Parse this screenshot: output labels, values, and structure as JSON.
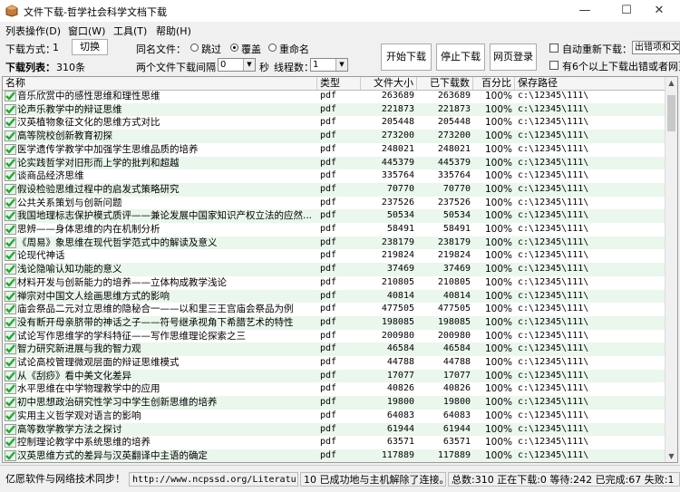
{
  "window": {
    "title": "文件下载-哲学社会科学文档下载",
    "minimize": "—",
    "maximize": "☐",
    "close": "✕"
  },
  "menu": [
    "列表操作(D)",
    "窗口(W)",
    "工具(T)",
    "帮助(H)"
  ],
  "toolbar": {
    "download_mode_label": "下载方式：",
    "download_mode_value": "1",
    "switch_button": "切换",
    "download_list_label": "下载列表：",
    "download_list_count": "310条",
    "same_name_label": "同名文件：",
    "radio_skip": "跳过",
    "radio_overwrite": "覆盖",
    "radio_rename": "重命名",
    "interval_label": "两个文件下载间隔：",
    "interval_value": "0",
    "interval_unit": "秒",
    "threads_label": "线程数：",
    "threads_value": "1",
    "start_button": "开始下载",
    "stop_button": "停止下载",
    "login_button": "网页登录",
    "auto_redownload_label": "自动重新下载：",
    "auto_redownload_value": "出错项和文",
    "above_six_label": "有6个以上下载出错或者网页"
  },
  "table": {
    "columns": [
      "名称",
      "类型",
      "文件大小",
      "已下载数",
      "百分比",
      "保存路径"
    ],
    "rows": [
      [
        "音乐欣赏中的感性思维和理性思维",
        "pdf",
        "263689",
        "263689",
        "100%",
        "c:\\12345\\111\\"
      ],
      [
        "论声乐教学中的辩证思维",
        "pdf",
        "221873",
        "221873",
        "100%",
        "c:\\12345\\111\\"
      ],
      [
        "汉英植物象征文化的思维方式对比",
        "pdf",
        "205448",
        "205448",
        "100%",
        "c:\\12345\\111\\"
      ],
      [
        "高等院校创新教育初探",
        "pdf",
        "273200",
        "273200",
        "100%",
        "c:\\12345\\111\\"
      ],
      [
        "医学遗传学教学中加强学生思维品质的培养",
        "pdf",
        "248021",
        "248021",
        "100%",
        "c:\\12345\\111\\"
      ],
      [
        "论实践哲学对旧形而上学的批判和超越",
        "pdf",
        "445379",
        "445379",
        "100%",
        "c:\\12345\\111\\"
      ],
      [
        "谈商品经济思维",
        "pdf",
        "335764",
        "335764",
        "100%",
        "c:\\12345\\111\\"
      ],
      [
        "假设检验思维过程中的启发式策略研究",
        "pdf",
        "70770",
        "70770",
        "100%",
        "c:\\12345\\111\\"
      ],
      [
        "公共关系策划与创新问题",
        "pdf",
        "237526",
        "237526",
        "100%",
        "c:\\12345\\111\\"
      ],
      [
        "我国地理标志保护模式质评——兼论发展中国家知识产权立法的应然...",
        "pdf",
        "50534",
        "50534",
        "100%",
        "c:\\12345\\111\\"
      ],
      [
        "思辨——身体思维的内在机制分析",
        "pdf",
        "58491",
        "58491",
        "100%",
        "c:\\12345\\111\\"
      ],
      [
        "《周易》象思维在现代哲学范式中的解读及意义",
        "pdf",
        "238179",
        "238179",
        "100%",
        "c:\\12345\\111\\"
      ],
      [
        "论现代神话",
        "pdf",
        "219824",
        "219824",
        "100%",
        "c:\\12345\\111\\"
      ],
      [
        "浅论隐喻认知功能的意义",
        "pdf",
        "37469",
        "37469",
        "100%",
        "c:\\12345\\111\\"
      ],
      [
        "材料开发与创新能力的培养——立体构成教学浅论",
        "pdf",
        "210805",
        "210805",
        "100%",
        "c:\\12345\\111\\"
      ],
      [
        "禅宗对中国文人绘画思维方式的影响",
        "pdf",
        "40814",
        "40814",
        "100%",
        "c:\\12345\\111\\"
      ],
      [
        "庙会祭品二元对立思维的隐秘合一——以和里三王宫庙会祭品为例",
        "pdf",
        "477505",
        "477505",
        "100%",
        "c:\\12345\\111\\"
      ],
      [
        "没有断开母亲脐带的神话之子——符号继承视角下希腊艺术的特性",
        "pdf",
        "198085",
        "198085",
        "100%",
        "c:\\12345\\111\\"
      ],
      [
        "试论写作思维学的学科特征——写作思维理论探索之三",
        "pdf",
        "200980",
        "200980",
        "100%",
        "c:\\12345\\111\\"
      ],
      [
        "智力研究新进展与我的智力观",
        "pdf",
        "46584",
        "46584",
        "100%",
        "c:\\12345\\111\\"
      ],
      [
        "试论高校管理微观层面的辩证思维模式",
        "pdf",
        "44788",
        "44788",
        "100%",
        "c:\\12345\\111\\"
      ],
      [
        "从《刮痧》看中美文化差异",
        "pdf",
        "17077",
        "17077",
        "100%",
        "c:\\12345\\111\\"
      ],
      [
        "水平思维在中学物理教学中的应用",
        "pdf",
        "40826",
        "40826",
        "100%",
        "c:\\12345\\111\\"
      ],
      [
        "初中思想政治研究性学习中学生创新思维的培养",
        "pdf",
        "19800",
        "19800",
        "100%",
        "c:\\12345\\111\\"
      ],
      [
        "实用主义哲学观对语言的影响",
        "pdf",
        "64083",
        "64083",
        "100%",
        "c:\\12345\\111\\"
      ],
      [
        "高等数学教学方法之探讨",
        "pdf",
        "61944",
        "61944",
        "100%",
        "c:\\12345\\111\\"
      ],
      [
        "控制理论教学中系统思维的培养",
        "pdf",
        "63571",
        "63571",
        "100%",
        "c:\\12345\\111\\"
      ],
      [
        "汉英思维方式的差异与汉英翻译中主语的确定",
        "pdf",
        "117889",
        "117889",
        "100%",
        "c:\\12345\\111\\"
      ]
    ]
  },
  "status": {
    "company": "亿愿软件与网络技术同步！",
    "url": "http://www.ncpssd.org/Literature/Do",
    "message": "10 已成功地与主机解除了连接。",
    "summary": "总数:310 正在下载:0 等待:242 已完成:67 失败:1"
  },
  "colors": {
    "check_green": "#22a832",
    "alt_row": "#eaf7ec"
  }
}
